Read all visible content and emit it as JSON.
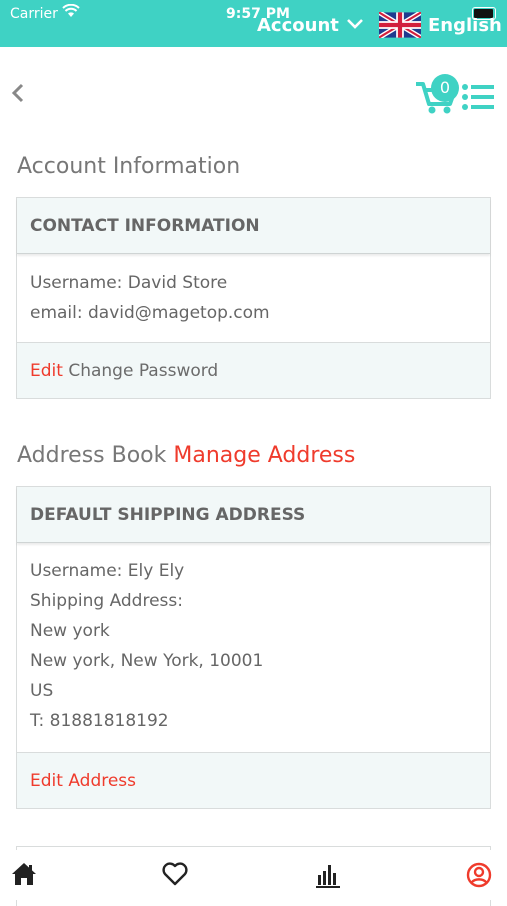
{
  "status_bar": {
    "carrier": "Carrier",
    "time": "9:57 PM"
  },
  "header": {
    "account_label": "Account",
    "language_label": "English"
  },
  "cart": {
    "count": "0"
  },
  "account_info": {
    "title": "Account Information",
    "contact_heading": "CONTACT INFORMATION",
    "username_line": "Username:  David Store",
    "email_line": "email: david@magetop.com",
    "edit_label": "Edit",
    "change_password_label": "Change Password"
  },
  "address_book": {
    "title": "Address Book",
    "manage_label": "Manage  Address",
    "shipping_heading": "DEFAULT SHIPPING ADDRESS",
    "lines": [
      "Username: Ely Ely",
      "Shipping Address:",
      "New york",
      "New york, New York, 10001",
      "US",
      "T:  81881818192"
    ],
    "edit_address_label": "Edit Address"
  },
  "colors": {
    "accent": "#3fd2c4",
    "link": "#ef3b2c",
    "panel": "#f2f8f8"
  },
  "tabs": [
    {
      "icon": "home-icon"
    },
    {
      "icon": "heart-icon"
    },
    {
      "icon": "chart-icon"
    },
    {
      "icon": "account-icon"
    }
  ]
}
